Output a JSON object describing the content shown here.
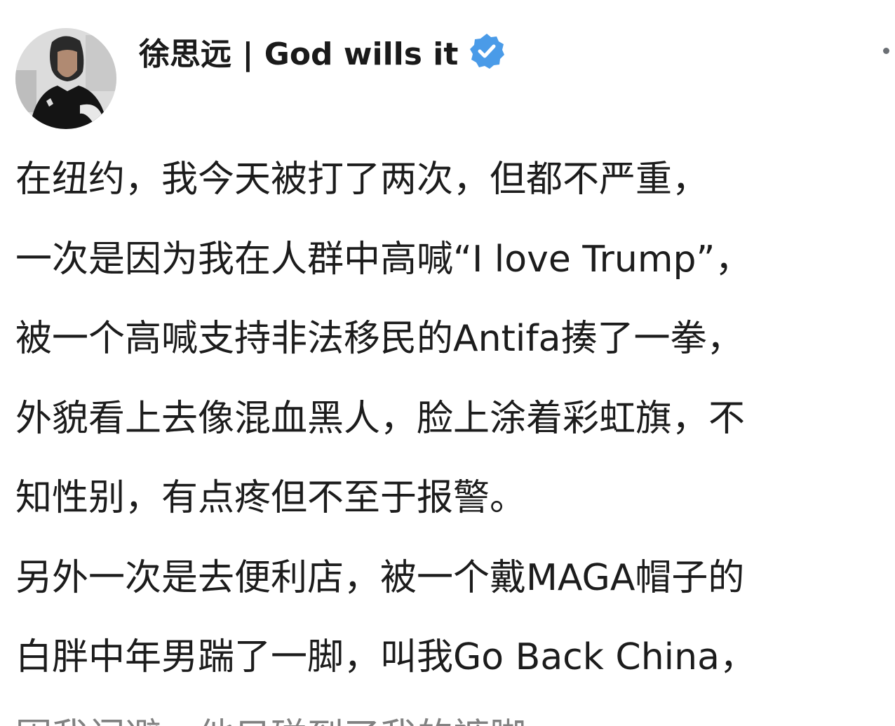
{
  "post": {
    "author": {
      "display_name": "徐思远 | God wills it",
      "avatar_icon": "user-photo-avatar",
      "verified_icon": "verified-badge-icon",
      "verified_color": "#4a9be8"
    },
    "menu_icon": "more-options-icon",
    "lines": [
      "在纽约，我今天被打了两次，但都不严重，",
      "一次是因为我在人群中高喊“I love Trump”，",
      "被一个高喊支持非法移民的Antifa揍了一拳，",
      "外貌看上去像混血黑人，脸上涂着彩虹旗，不",
      "知性别，有点疼但不至于报警。",
      "另外一次是去便利店，被一个戴MAGA帽子的",
      "白胖中年男踹了一脚，叫我Go Back China，",
      "因我闪避，他只碰到了我的裤脚"
    ]
  }
}
